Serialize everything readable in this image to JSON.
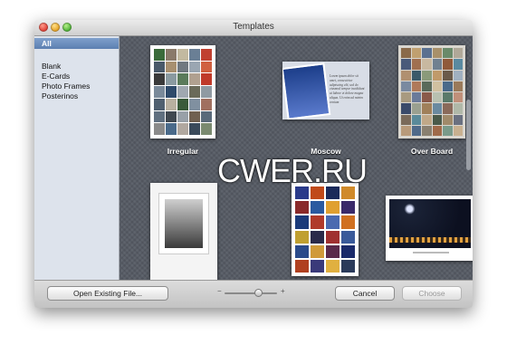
{
  "window": {
    "title": "Templates"
  },
  "sidebar": {
    "items": [
      {
        "label": "All",
        "selected": true
      },
      {
        "label": "Blank"
      },
      {
        "label": "E-Cards"
      },
      {
        "label": "Photo Frames"
      },
      {
        "label": "Posterinos"
      }
    ]
  },
  "templates": [
    {
      "label": "Irregular"
    },
    {
      "label": "Moscow"
    },
    {
      "label": "Over Board"
    },
    {
      "label": ""
    },
    {
      "label": ""
    },
    {
      "label": ""
    }
  ],
  "moscow_card_text": "Lorem ipsum dolor sit amet, consectetur adipiscing elit, sed do eiusmod tempor incididunt ut labore et dolore magna aliqua. Ut enim ad minim veniam",
  "watermark": "CWER.RU",
  "bottom": {
    "open_label": "Open Existing File...",
    "cancel_label": "Cancel",
    "choose_label": "Choose",
    "zoom_minus": "−",
    "zoom_plus": "+"
  },
  "colors": {
    "content_bg": "#555a63",
    "selection": "#5b7fb1",
    "sidebar_bg": "#dde3ec"
  }
}
